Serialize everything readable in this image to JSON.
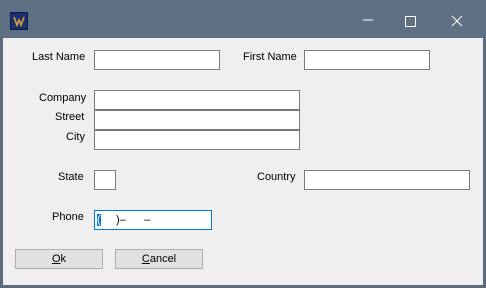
{
  "window": {
    "icon": "app-logo-icon",
    "controls": [
      "minimize-icon",
      "maximize-icon",
      "close-icon"
    ]
  },
  "form": {
    "last_name": {
      "label": "Last Name",
      "value": ""
    },
    "first_name": {
      "label": "First Name",
      "value": ""
    },
    "company": {
      "label": "Company",
      "value": ""
    },
    "street": {
      "label": "Street",
      "value": ""
    },
    "city": {
      "label": "City",
      "value": ""
    },
    "state": {
      "label": "State",
      "value": ""
    },
    "country": {
      "label": "Country",
      "value": ""
    },
    "phone": {
      "label": "Phone",
      "mask_first": "(",
      "mask_rest": "     )–      –"
    }
  },
  "buttons": {
    "ok_mnemonic": "O",
    "ok_rest": "k",
    "cancel_mnemonic": "C",
    "cancel_rest": "ancel"
  },
  "colors": {
    "titlebar": "#5f6f84",
    "client": "#efefef",
    "focus_border": "#0078d7"
  }
}
